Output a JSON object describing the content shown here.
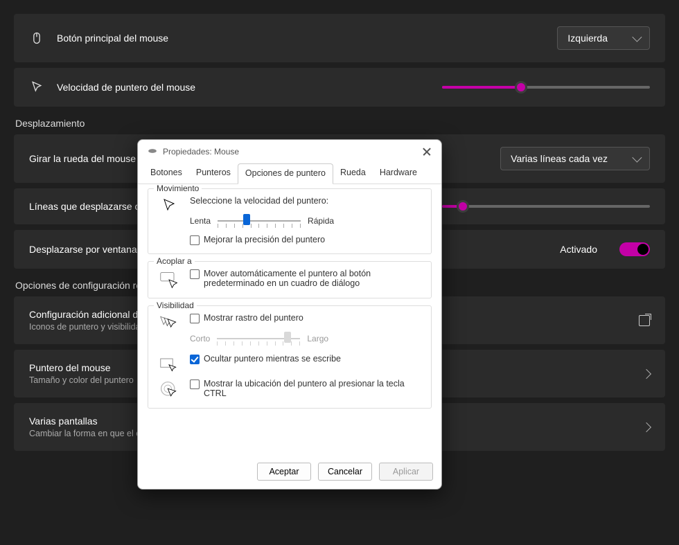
{
  "settings": {
    "row_primary": {
      "label": "Botón principal del mouse",
      "dropdown": "Izquierda"
    },
    "row_speed": {
      "label": "Velocidad de puntero del mouse",
      "slider_pct": 38
    },
    "section_scroll": "Desplazamiento",
    "row_wheel": {
      "label": "Girar la rueda del mouse para desplazarse",
      "dropdown": "Varias líneas cada vez"
    },
    "row_lines": {
      "label": "Líneas que desplazarse cada vez",
      "slider_pct": 10
    },
    "row_inactive": {
      "label": "Desplazarse por ventanas inactivas al pasar el mouse",
      "status": "Activado"
    },
    "section_related": "Opciones de configuración relacionadas",
    "row_additional": {
      "label": "Configuración adicional del mouse",
      "sub": "Iconos de puntero y visibilidad"
    },
    "row_pointer": {
      "label": "Puntero del mouse",
      "sub": "Tamaño y color del puntero"
    },
    "row_screens": {
      "label": "Varias pantallas",
      "sub": "Cambiar la forma en que el cursor se mueve por encima de los límites de visualización"
    }
  },
  "dialog": {
    "title": "Propiedades: Mouse",
    "tabs": [
      "Botones",
      "Punteros",
      "Opciones de puntero",
      "Rueda",
      "Hardware"
    ],
    "active_tab": 2,
    "group_motion": {
      "title": "Movimiento",
      "label_speed": "Seleccione la velocidad del puntero:",
      "slow": "Lenta",
      "fast": "Rápida",
      "slider_pct": 35,
      "chk_precision": {
        "label": "Mejorar la precisión del puntero",
        "checked": false
      }
    },
    "group_snap": {
      "title": "Acoplar a",
      "chk": {
        "label": "Mover automáticamente el puntero al botón predeterminado en un cuadro de diálogo",
        "checked": false
      }
    },
    "group_vis": {
      "title": "Visibilidad",
      "chk_trail": {
        "label": "Mostrar rastro del puntero",
        "checked": false
      },
      "trail_short": "Corto",
      "trail_long": "Largo",
      "trail_pct": 85,
      "chk_hide": {
        "label": "Ocultar puntero mientras se escribe",
        "checked": true
      },
      "chk_ctrl": {
        "label": "Mostrar la ubicación del puntero al presionar la tecla CTRL",
        "checked": false
      }
    },
    "buttons": {
      "ok": "Aceptar",
      "cancel": "Cancelar",
      "apply": "Aplicar"
    }
  }
}
